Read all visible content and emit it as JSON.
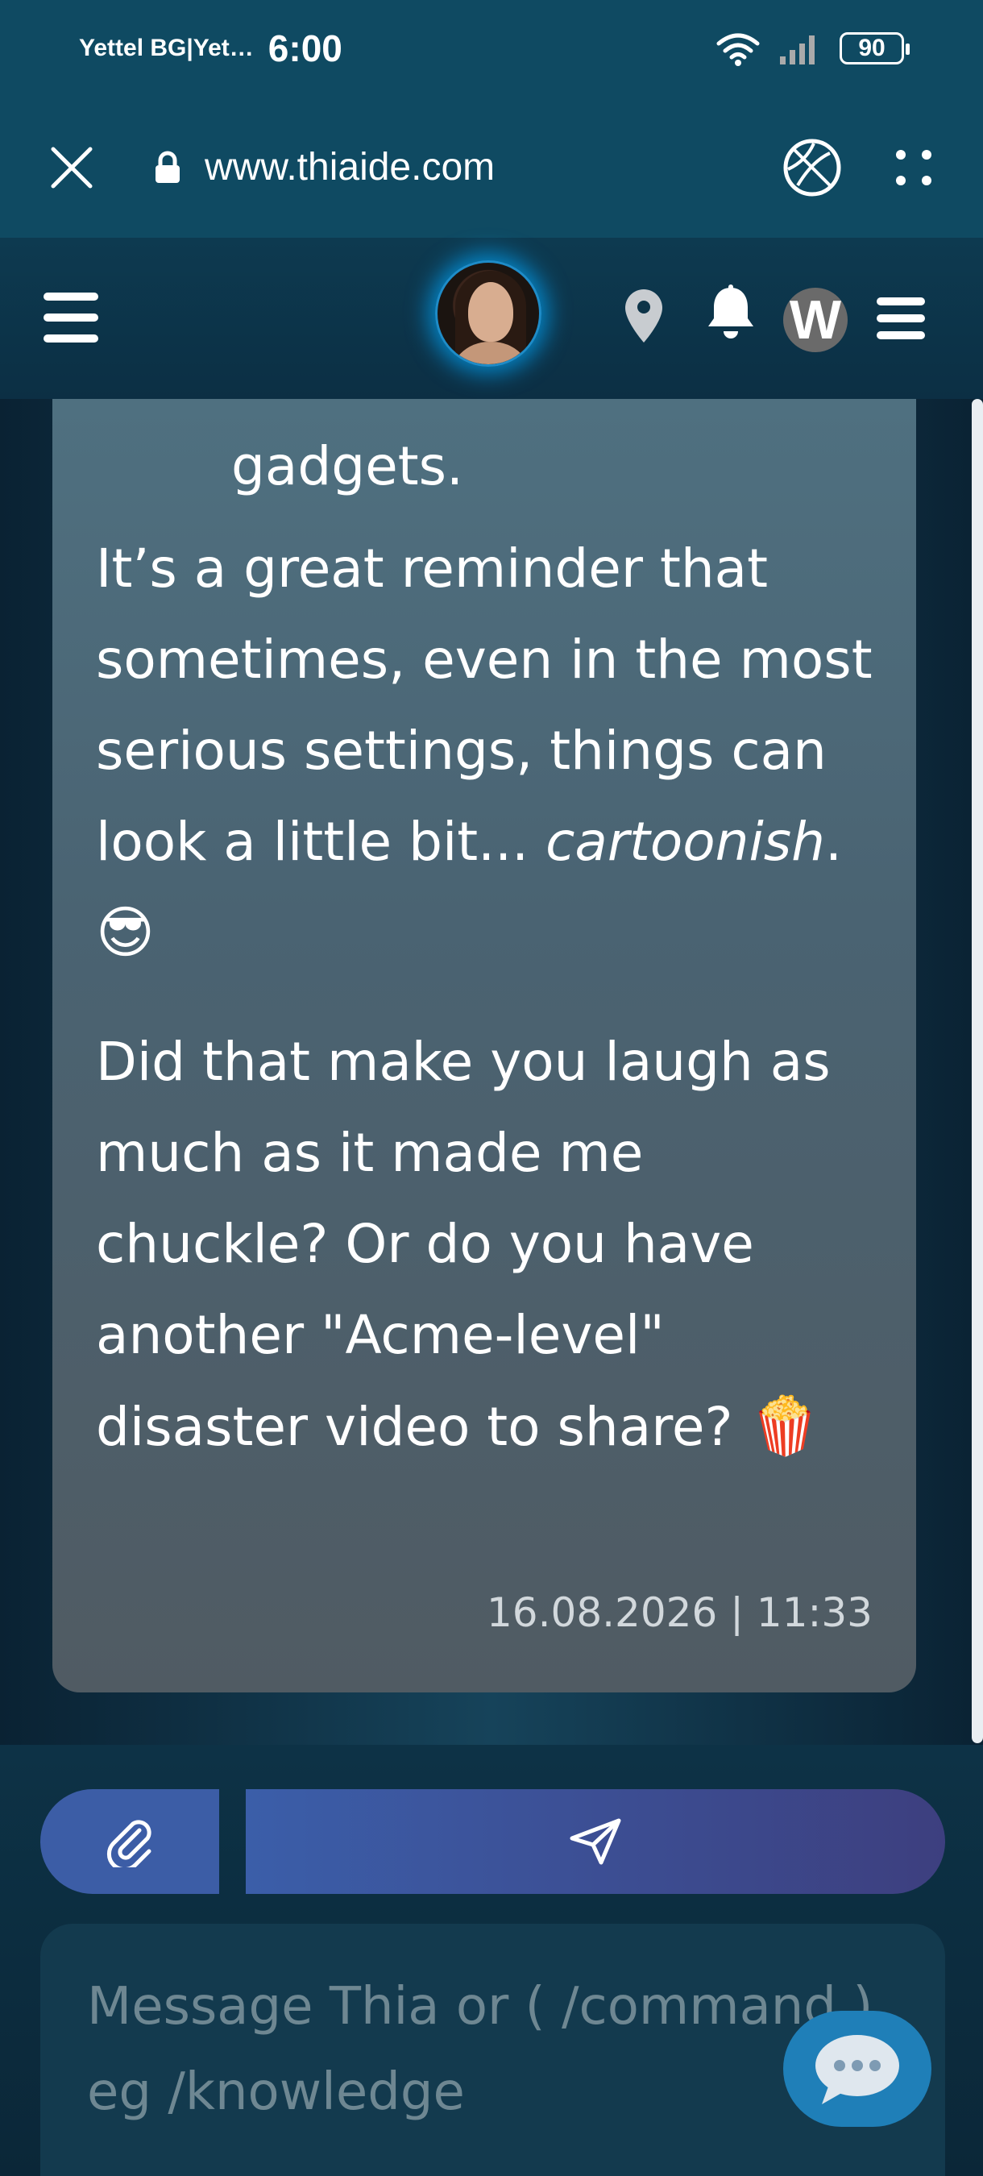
{
  "status_bar": {
    "carrier": "Yettel BG|Yet…",
    "time": "6:00",
    "battery": "90"
  },
  "browser": {
    "url": "www.thiaide.com"
  },
  "header": {
    "user_initial": "W"
  },
  "message": {
    "lead": "gadgets.",
    "para1": "It’s a great reminder that sometimes, even in the most serious settings, things can look a little bit...",
    "para1_em": "cartoonish",
    "para1_tail": ".",
    "para1_emoji": "😎",
    "para2": "Did that make you laugh as much as it made me chuckle? Or do you have another \"Acme-level\" disaster video to share?",
    "para2_emoji": "🍿",
    "timestamp": "16.08.2026 | 11:33"
  },
  "composer": {
    "placeholder": "Message Thia or ( /command ) eg /knowledge"
  },
  "icons": {
    "close": "close-icon",
    "lock": "lock-icon",
    "globe": "globe-icon",
    "more": "more-dots-icon",
    "menu_left": "hamburger-menu-icon",
    "location": "location-pin-icon",
    "bell": "bell-icon",
    "menu_right": "hamburger-menu-icon",
    "attach": "paperclip-icon",
    "send": "send-icon",
    "chat_bubble": "chat-bubble-icon"
  },
  "colors": {
    "status_bg": "#0f4a62",
    "bubble": "#4f6a78",
    "send_button": "#3b5ea9",
    "fab": "#1f7fb8"
  }
}
